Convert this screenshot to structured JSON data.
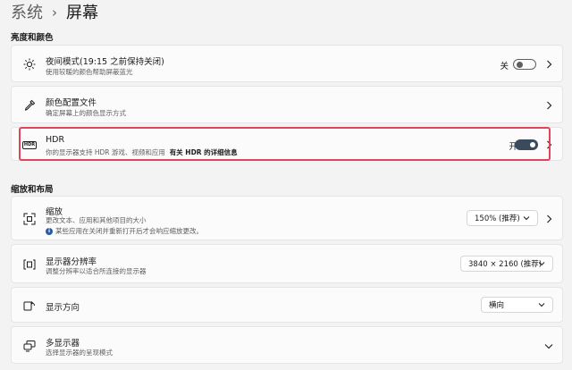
{
  "breadcrumb": {
    "parent": "系统",
    "separator": "›",
    "current": "屏幕"
  },
  "sections": {
    "brightness_color": "亮度和颜色",
    "scale_layout": "缩放和布局"
  },
  "night_light": {
    "title": "夜间模式(19:15 之前保持关闭)",
    "subtitle": "使用较暖的颜色帮助屏蔽蓝光",
    "toggle_label": "关",
    "toggle_on": false
  },
  "color_profile": {
    "title": "颜色配置文件",
    "subtitle": "确定屏幕上的颜色显示方式"
  },
  "hdr": {
    "title": "HDR",
    "subtitle": "你的显示器支持 HDR 游戏、视频和应用",
    "link": "有关 HDR 的详细信息",
    "toggle_label": "开",
    "toggle_on": true,
    "highlight_color": "#e0455b",
    "icon_text": "HDR"
  },
  "scale": {
    "title": "缩放",
    "subtitle": "更改文本、应用和其他项目的大小",
    "notice": "某些应用在关闭并重新打开后才会响应缩放更改。",
    "value": "150% (推荐)"
  },
  "resolution": {
    "title": "显示器分辨率",
    "subtitle": "调整分辨率以适合所连接的显示器",
    "value": "3840 × 2160 (推荐)"
  },
  "orientation": {
    "title": "显示方向",
    "value": "横向"
  },
  "multi_display": {
    "title": "多显示器",
    "subtitle": "选择显示器的呈现模式"
  },
  "colors": {
    "accent": "#3a4b5e",
    "highlight": "#e0455b"
  }
}
